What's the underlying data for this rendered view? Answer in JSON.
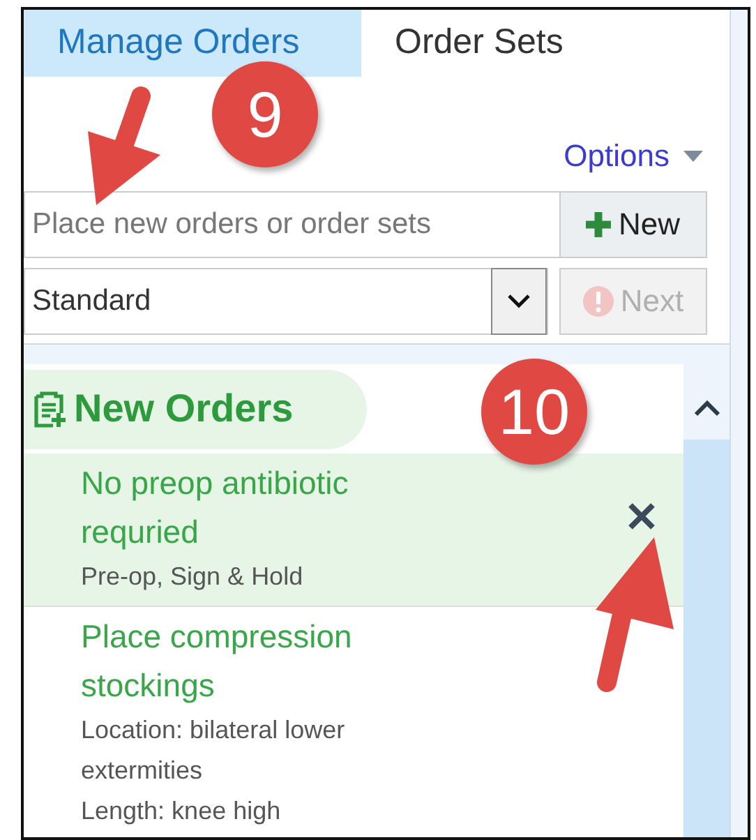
{
  "tabs": [
    {
      "label": "Manage Orders",
      "selected": true
    },
    {
      "label": "Order Sets",
      "selected": false
    }
  ],
  "options_menu": {
    "label": "Options"
  },
  "order_search": {
    "placeholder": "Place new orders or order sets"
  },
  "new_button": {
    "label": "New",
    "disabled": false
  },
  "mode_select": {
    "value": "Standard"
  },
  "next_button": {
    "label": "Next",
    "disabled": true
  },
  "section": {
    "title": "New Orders"
  },
  "orders": [
    {
      "title": "No preop antibiotic requried",
      "details": [
        "Pre-op, Sign & Hold"
      ],
      "selected": true
    },
    {
      "title": "Place compression stockings",
      "details": [
        "Location: bilateral lower extermities",
        "Length: knee high"
      ],
      "selected": false
    }
  ],
  "callouts": [
    {
      "text": "9"
    },
    {
      "text": "10"
    }
  ]
}
